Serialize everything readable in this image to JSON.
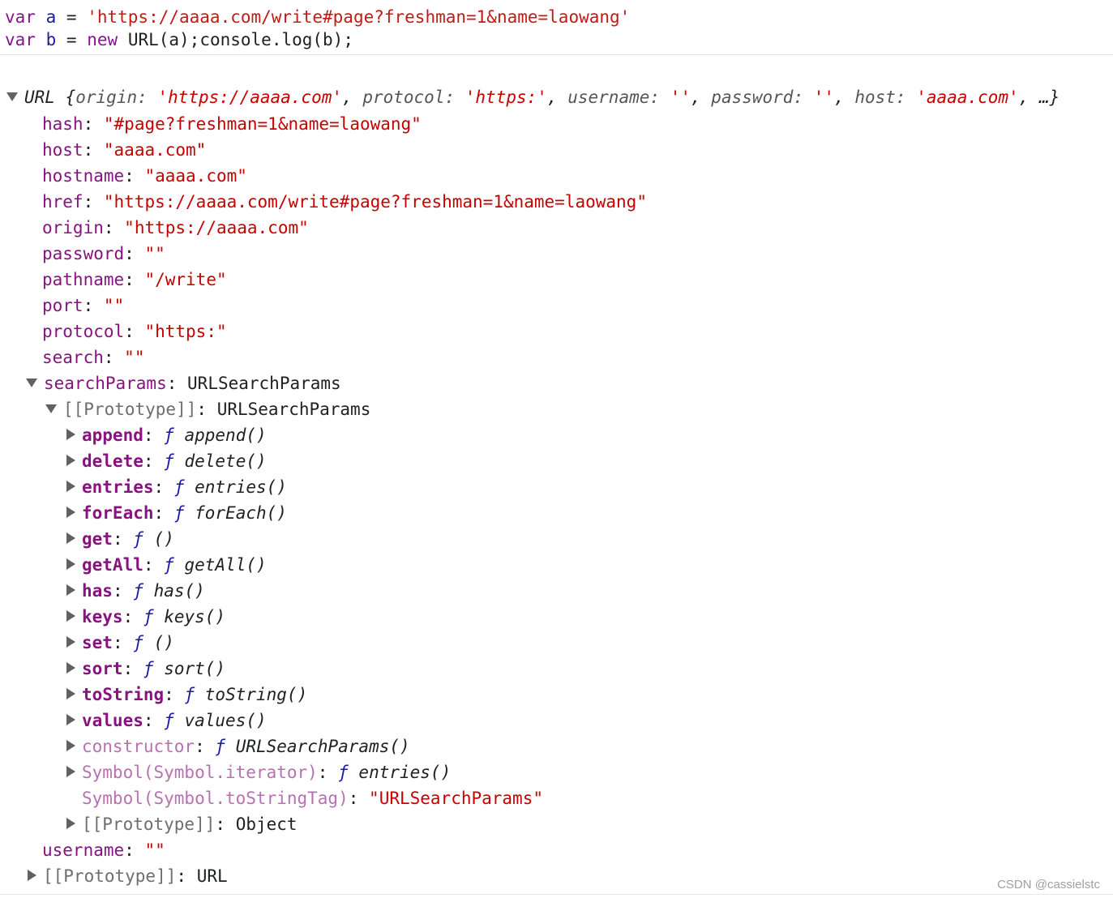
{
  "input": {
    "line1": {
      "kw": "var",
      "name": "a",
      "eq": "=",
      "value": "'https://aaaa.com/write#page?freshman=1&name=laowang'"
    },
    "line2": {
      "kw": "var",
      "name": "b",
      "eq": "=",
      "new_kw": "new",
      "rest": "URL(a);console.log(b);"
    }
  },
  "summary": {
    "label": "URL",
    "open": "{",
    "k_origin": "origin:",
    "v_origin": "'https://aaaa.com'",
    "k_protocol": "protocol:",
    "v_protocol": "'https:'",
    "k_username": "username:",
    "v_username": "''",
    "k_password": "password:",
    "v_password": "''",
    "k_host": "host:",
    "v_host": "'aaaa.com'",
    "sep": ",",
    "ellipsis": "…}"
  },
  "props": [
    {
      "key": "hash",
      "value": "\"#page?freshman=1&name=laowang\""
    },
    {
      "key": "host",
      "value": "\"aaaa.com\""
    },
    {
      "key": "hostname",
      "value": "\"aaaa.com\""
    },
    {
      "key": "href",
      "value": "\"https://aaaa.com/write#page?freshman=1&name=laowang\""
    },
    {
      "key": "origin",
      "value": "\"https://aaaa.com\""
    },
    {
      "key": "password",
      "value": "\"\""
    },
    {
      "key": "pathname",
      "value": "\"/write\""
    },
    {
      "key": "port",
      "value": "\"\""
    },
    {
      "key": "protocol",
      "value": "\"https:\""
    },
    {
      "key": "search",
      "value": "\"\""
    }
  ],
  "searchParams": {
    "key": "searchParams",
    "value": "URLSearchParams"
  },
  "protoSP": {
    "key": "[[Prototype]]",
    "value": "URLSearchParams"
  },
  "methods": [
    {
      "key": "append",
      "f": "ƒ",
      "name": "append()"
    },
    {
      "key": "delete",
      "f": "ƒ",
      "name": "delete()"
    },
    {
      "key": "entries",
      "f": "ƒ",
      "name": "entries()"
    },
    {
      "key": "forEach",
      "f": "ƒ",
      "name": "forEach()"
    },
    {
      "key": "get",
      "f": "ƒ",
      "name": "()"
    },
    {
      "key": "getAll",
      "f": "ƒ",
      "name": "getAll()"
    },
    {
      "key": "has",
      "f": "ƒ",
      "name": "has()"
    },
    {
      "key": "keys",
      "f": "ƒ",
      "name": "keys()"
    },
    {
      "key": "set",
      "f": "ƒ",
      "name": "()"
    },
    {
      "key": "sort",
      "f": "ƒ",
      "name": "sort()"
    },
    {
      "key": "toString",
      "f": "ƒ",
      "name": "toString()"
    },
    {
      "key": "values",
      "f": "ƒ",
      "name": "values()"
    }
  ],
  "constructor": {
    "key": "constructor",
    "f": "ƒ",
    "name": "URLSearchParams()"
  },
  "symIter": {
    "key": "Symbol(Symbol.iterator)",
    "f": "ƒ",
    "name": "entries()"
  },
  "symTag": {
    "key": "Symbol(Symbol.toStringTag)",
    "value": "\"URLSearchParams\""
  },
  "protoObj": {
    "key": "[[Prototype]]",
    "value": "Object"
  },
  "username": {
    "key": "username",
    "value": "\"\""
  },
  "protoURL": {
    "key": "[[Prototype]]",
    "value": "URL"
  },
  "colon": ":",
  "watermark": "CSDN @cassielstc",
  "colors": {
    "key": "#881280",
    "string": "#c80000",
    "keyword": "#aa0d91"
  }
}
